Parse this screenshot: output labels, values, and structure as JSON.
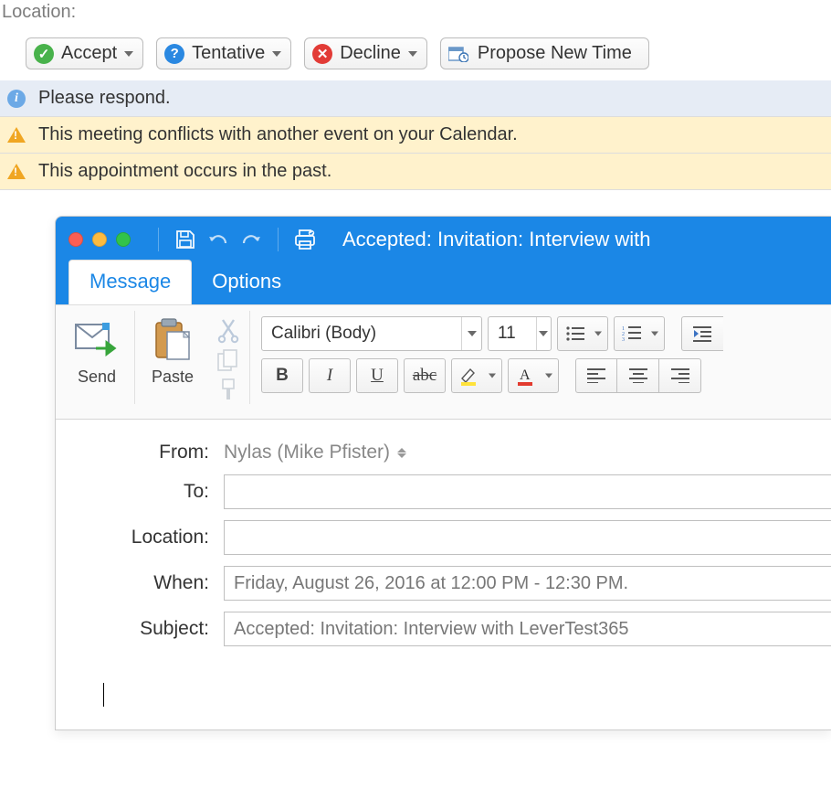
{
  "top": {
    "location_label": "Location:"
  },
  "responses": {
    "accept": "Accept",
    "tentative": "Tentative",
    "decline": "Decline",
    "propose": "Propose New Time"
  },
  "notifications": {
    "info": "Please respond.",
    "warn1": "This meeting conflicts with another event on your Calendar.",
    "warn2": "This appointment occurs in the past."
  },
  "window": {
    "title": "Accepted: Invitation: Interview with",
    "tabs": {
      "message": "Message",
      "options": "Options"
    }
  },
  "ribbon": {
    "send": "Send",
    "paste": "Paste",
    "font": "Calibri (Body)",
    "size": "11"
  },
  "fields": {
    "from_label": "From:",
    "from_value": "Nylas (Mike Pfister)",
    "to_label": "To:",
    "to_value": "",
    "location_label": "Location:",
    "location_value": "",
    "when_label": "When:",
    "when_value": "Friday, August 26, 2016 at 12:00 PM - 12:30 PM.",
    "subject_label": "Subject:",
    "subject_value": "Accepted: Invitation: Interview with LeverTest365"
  }
}
